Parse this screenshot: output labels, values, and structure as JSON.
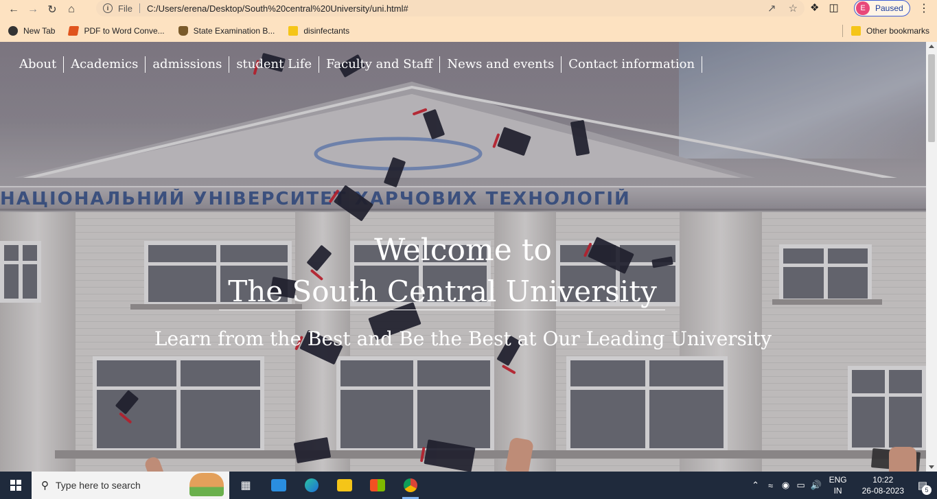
{
  "browser": {
    "file_label": "File",
    "url": "C:/Users/erena/Desktop/South%20central%20University/uni.html#",
    "profile_initial": "E",
    "profile_status": "Paused",
    "icons": [
      "back-arrow-icon",
      "forward-arrow-icon",
      "reload-icon",
      "home-icon",
      "info-icon",
      "share-icon",
      "star-icon",
      "puzzle-icon",
      "side-panel-icon",
      "menu-dots-icon"
    ]
  },
  "bookmarks": {
    "items": [
      {
        "label": "New Tab",
        "icon": "globe-icon"
      },
      {
        "label": "PDF to Word Conve...",
        "icon": "pdf-icon"
      },
      {
        "label": "State Examination B...",
        "icon": "emblem-icon"
      },
      {
        "label": "disinfectants",
        "icon": "folder-icon"
      }
    ],
    "other": "Other bookmarks"
  },
  "site": {
    "nav": [
      "About",
      "Academics",
      "admissions",
      "student Life",
      "Faculty and Staff",
      "News and events",
      "Contact information"
    ],
    "hero": {
      "line1": "Welcome to",
      "line2": "The South Central University",
      "subtitle": "Learn from the Best and Be the Best at Our Leading University"
    },
    "frieze": "НАЦІОНАЛЬНИЙ УНІВЕРСИТЕТ ХАРЧОВИХ ТЕХНОЛОГІЙ"
  },
  "taskbar": {
    "search_placeholder": "Type here to search",
    "lang_top": "ENG",
    "lang_bottom": "IN",
    "time": "10:22",
    "date": "26-08-2023",
    "notifications": "5"
  },
  "colors": {
    "browser_chrome": "#fde2c1",
    "profile_avatar": "#e8487a",
    "taskbar": "#1f2a3c"
  }
}
